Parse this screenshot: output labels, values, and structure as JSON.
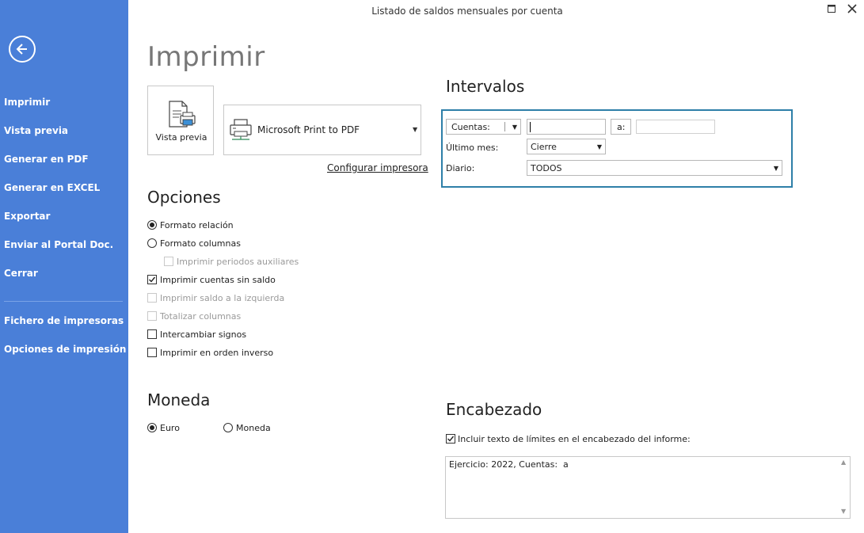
{
  "window": {
    "title": "Listado de saldos mensuales por cuenta"
  },
  "colors": {
    "sidebar": "#4a7fd8",
    "accent_border": "#2e7fa8"
  },
  "sidebar": {
    "items": [
      {
        "label": "Imprimir"
      },
      {
        "label": "Vista previa"
      },
      {
        "label": "Generar en PDF"
      },
      {
        "label": "Generar en EXCEL"
      },
      {
        "label": "Exportar"
      },
      {
        "label": "Enviar al Portal Doc."
      },
      {
        "label": "Cerrar"
      }
    ],
    "secondary": [
      {
        "label": "Fichero de impresoras"
      },
      {
        "label": "Opciones de impresión"
      }
    ]
  },
  "main": {
    "title": "Imprimir",
    "preview_button": "Vista previa",
    "printer": {
      "name": "Microsoft Print to PDF"
    },
    "configure_link": "Configurar impresora"
  },
  "options": {
    "title": "Opciones",
    "items": [
      {
        "label": "Formato relación",
        "type": "radio",
        "checked": true,
        "enabled": true
      },
      {
        "label": "Formato columnas",
        "type": "radio",
        "checked": false,
        "enabled": true
      },
      {
        "label": "Imprimir periodos auxiliares",
        "type": "checkbox",
        "checked": false,
        "enabled": false
      },
      {
        "label": "Imprimir cuentas sin saldo",
        "type": "checkbox",
        "checked": true,
        "enabled": true
      },
      {
        "label": "Imprimir saldo a la izquierda",
        "type": "checkbox",
        "checked": false,
        "enabled": false
      },
      {
        "label": "Totalizar columnas",
        "type": "checkbox",
        "checked": false,
        "enabled": false
      },
      {
        "label": "Intercambiar signos",
        "type": "checkbox",
        "checked": false,
        "enabled": true
      },
      {
        "label": "Imprimir en orden inverso",
        "type": "checkbox",
        "checked": false,
        "enabled": true
      }
    ]
  },
  "moneda": {
    "title": "Moneda",
    "options": [
      {
        "label": "Euro",
        "checked": true
      },
      {
        "label": "Moneda",
        "checked": false
      }
    ]
  },
  "intervalos": {
    "title": "Intervalos",
    "range_type": "Cuentas:",
    "from_value": "",
    "to_label": "a:",
    "to_value": "",
    "ultimo_mes_label": "Último mes:",
    "ultimo_mes_value": "Cierre",
    "diario_label": "Diario:",
    "diario_value": "TODOS"
  },
  "encabezado": {
    "title": "Encabezado",
    "include_label": "Incluir texto de límites en el encabezado del informe:",
    "include_checked": true,
    "text": "Ejercicio: 2022, Cuentas:  a"
  }
}
